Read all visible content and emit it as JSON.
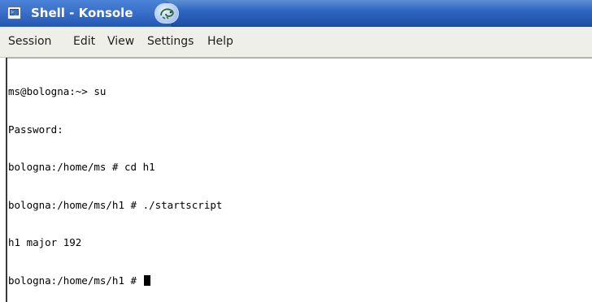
{
  "window": {
    "title": "Shell - Konsole",
    "app_icon": "konsole-terminal-icon",
    "tab_button_icon": "suse-chameleon-icon"
  },
  "menubar": {
    "items": [
      "Session",
      "Edit",
      "View",
      "Settings",
      "Help"
    ]
  },
  "terminal": {
    "lines": [
      "ms@bologna:~> su",
      "Password:",
      "bologna:/home/ms # cd h1",
      "bologna:/home/ms/h1 # ./startscript",
      "h1 major 192",
      "bologna:/home/ms/h1 # "
    ]
  },
  "colors": {
    "titlebar": "#2f66c0",
    "menubar": "#efefe9",
    "terminal_bg": "#ffffff",
    "terminal_fg": "#000000"
  }
}
